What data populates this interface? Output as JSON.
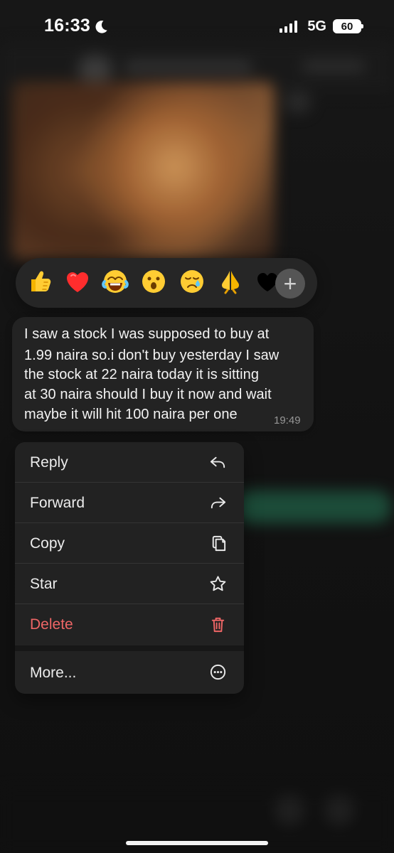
{
  "status_bar": {
    "time": "16:33",
    "network": "5G",
    "battery": "60"
  },
  "reaction_bar": {
    "emojis": [
      "👍",
      "❤️",
      "😂",
      "😮",
      "😢",
      "🙏",
      "🖤"
    ],
    "add_label": "+"
  },
  "message": {
    "lines": [
      "I saw a stock I was supposed to buy at",
      "1.99 naira so.i don't buy yesterday I saw",
      "the stock at 22 naira today  it is sitting",
      "at 30 naira should I buy it now and wait",
      "maybe it will hit 100 naira per one"
    ],
    "time": "19:49"
  },
  "context_menu": {
    "reply": "Reply",
    "forward": "Forward",
    "copy": "Copy",
    "star": "Star",
    "delete": "Delete",
    "more": "More..."
  },
  "colors": {
    "background": "#141414",
    "panel": "#222222",
    "bubble": "#232323",
    "delete_red": "#ef6666",
    "muted_text": "#969696"
  }
}
